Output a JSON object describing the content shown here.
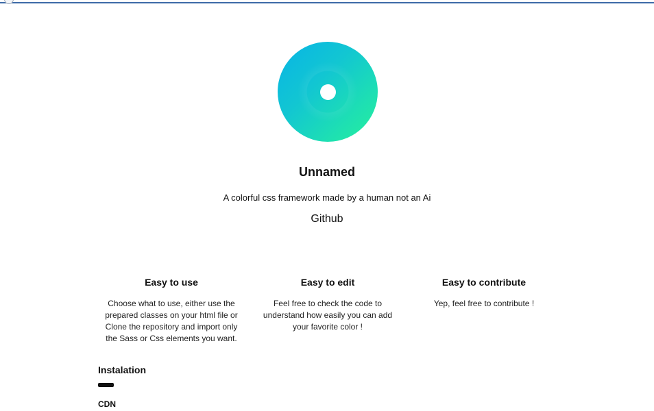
{
  "hero": {
    "title": "Unnamed",
    "tagline": "A colorful css framework made by a human not an Ai",
    "github_label": "Github",
    "logo_colors": [
      "#08b4e6",
      "#1ee0b2",
      "#27ef9c"
    ]
  },
  "features": [
    {
      "title": "Easy to use",
      "text": "Choose what to use, either use the prepared classes on your html file or Clone the repository and import only the Sass or Css elements you want."
    },
    {
      "title": "Easy to edit",
      "text": "Feel free to check the code to understand how easily you can add your favorite color !"
    },
    {
      "title": "Easy to contribute",
      "text": "Yep, feel free to contribute !"
    }
  ],
  "installation": {
    "heading": "Instalation",
    "cdn_heading": "CDN"
  }
}
